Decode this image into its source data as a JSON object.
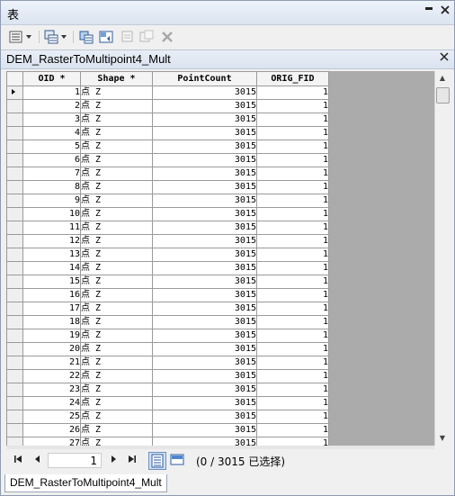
{
  "window": {
    "title": "表",
    "menu_icon": "▪",
    "close_icon": "✕"
  },
  "toolbar": {
    "icons": [
      "table-options-icon",
      "related-tables-icon",
      "select-by-attributes-icon",
      "switch-selection-icon",
      "clear-selection-icon",
      "delete-selected-icon",
      "delete-icon"
    ]
  },
  "table_tab": {
    "title": "DEM_RasterToMultipoint4_Mult"
  },
  "grid": {
    "columns": [
      "OID *",
      "Shape *",
      "PointCount",
      "ORIG_FID"
    ],
    "rows": [
      {
        "oid": "1",
        "shape": "点 Z",
        "count": "3015",
        "fid": "1"
      },
      {
        "oid": "2",
        "shape": "点 Z",
        "count": "3015",
        "fid": "1"
      },
      {
        "oid": "3",
        "shape": "点 Z",
        "count": "3015",
        "fid": "1"
      },
      {
        "oid": "4",
        "shape": "点 Z",
        "count": "3015",
        "fid": "1"
      },
      {
        "oid": "5",
        "shape": "点 Z",
        "count": "3015",
        "fid": "1"
      },
      {
        "oid": "6",
        "shape": "点 Z",
        "count": "3015",
        "fid": "1"
      },
      {
        "oid": "7",
        "shape": "点 Z",
        "count": "3015",
        "fid": "1"
      },
      {
        "oid": "8",
        "shape": "点 Z",
        "count": "3015",
        "fid": "1"
      },
      {
        "oid": "9",
        "shape": "点 Z",
        "count": "3015",
        "fid": "1"
      },
      {
        "oid": "10",
        "shape": "点 Z",
        "count": "3015",
        "fid": "1"
      },
      {
        "oid": "11",
        "shape": "点 Z",
        "count": "3015",
        "fid": "1"
      },
      {
        "oid": "12",
        "shape": "点 Z",
        "count": "3015",
        "fid": "1"
      },
      {
        "oid": "13",
        "shape": "点 Z",
        "count": "3015",
        "fid": "1"
      },
      {
        "oid": "14",
        "shape": "点 Z",
        "count": "3015",
        "fid": "1"
      },
      {
        "oid": "15",
        "shape": "点 Z",
        "count": "3015",
        "fid": "1"
      },
      {
        "oid": "16",
        "shape": "点 Z",
        "count": "3015",
        "fid": "1"
      },
      {
        "oid": "17",
        "shape": "点 Z",
        "count": "3015",
        "fid": "1"
      },
      {
        "oid": "18",
        "shape": "点 Z",
        "count": "3015",
        "fid": "1"
      },
      {
        "oid": "19",
        "shape": "点 Z",
        "count": "3015",
        "fid": "1"
      },
      {
        "oid": "20",
        "shape": "点 Z",
        "count": "3015",
        "fid": "1"
      },
      {
        "oid": "21",
        "shape": "点 Z",
        "count": "3015",
        "fid": "1"
      },
      {
        "oid": "22",
        "shape": "点 Z",
        "count": "3015",
        "fid": "1"
      },
      {
        "oid": "23",
        "shape": "点 Z",
        "count": "3015",
        "fid": "1"
      },
      {
        "oid": "24",
        "shape": "点 Z",
        "count": "3015",
        "fid": "1"
      },
      {
        "oid": "25",
        "shape": "点 Z",
        "count": "3015",
        "fid": "1"
      },
      {
        "oid": "26",
        "shape": "点 Z",
        "count": "3015",
        "fid": "1"
      },
      {
        "oid": "27",
        "shape": "点 Z",
        "count": "3015",
        "fid": "1"
      }
    ]
  },
  "navigation": {
    "first": "⏮",
    "prev": "◀",
    "current_record": "1",
    "next": "▶",
    "last": "⏭",
    "status": "(0 / 3015 已选择)"
  },
  "bottom_tab": {
    "label": "DEM_RasterToMultipoint4_Mult"
  }
}
